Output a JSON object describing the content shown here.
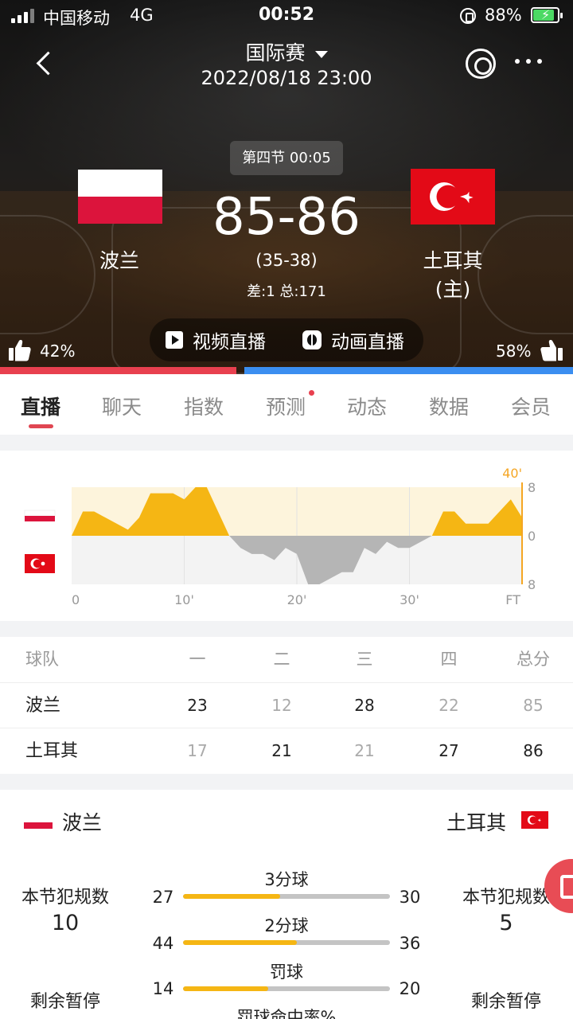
{
  "status_bar": {
    "carrier": "中国移动",
    "network": "4G",
    "time": "00:52",
    "battery": "88%",
    "battery_level": 0.88
  },
  "nav": {
    "title": "国际赛",
    "datetime": "2022/08/18 23:00"
  },
  "match": {
    "period": "第四节 00:05",
    "home": {
      "name": "波兰",
      "flag": "poland-flag"
    },
    "away": {
      "name": "土耳其",
      "tag": "(主)",
      "flag": "turkey-flag"
    },
    "score": "85-86",
    "halftime": "(35-38)",
    "diff_total": "差:1 总:171"
  },
  "live": {
    "video_label": "视频直播",
    "animation_label": "动画直播"
  },
  "support": {
    "home_pct_label": "42%",
    "away_pct_label": "58%",
    "home_share": 0.42,
    "home_color": "#e8404f",
    "away_color": "#3b8ef0"
  },
  "tabs": [
    {
      "label": "直播",
      "active": true
    },
    {
      "label": "聊天",
      "active": false
    },
    {
      "label": "指数",
      "active": false
    },
    {
      "label": "预测",
      "active": false,
      "dot": true
    },
    {
      "label": "动态",
      "active": false
    },
    {
      "label": "数据",
      "active": false
    },
    {
      "label": "会员",
      "active": false
    }
  ],
  "chart_data": {
    "type": "area",
    "x_tick_labels": [
      "0",
      "10'",
      "20'",
      "30'",
      "FT"
    ],
    "x_ticks": [
      0,
      10,
      20,
      30,
      40
    ],
    "y_tick_labels": [
      "8",
      "0",
      "8"
    ],
    "current_marker": "40'",
    "xlim": [
      0,
      40
    ],
    "ylim": [
      -8,
      8
    ],
    "positive_color": "#f5b614",
    "negative_color": "#b5b5b5",
    "marker_color": "#f5a623",
    "points": [
      [
        0,
        0
      ],
      [
        1,
        4
      ],
      [
        2,
        4
      ],
      [
        3,
        3
      ],
      [
        4,
        2
      ],
      [
        5,
        1
      ],
      [
        6,
        3
      ],
      [
        7,
        7
      ],
      [
        8,
        7
      ],
      [
        9,
        7
      ],
      [
        10,
        6
      ],
      [
        11,
        8
      ],
      [
        12,
        8
      ],
      [
        13,
        4
      ],
      [
        14,
        0
      ],
      [
        15,
        -2
      ],
      [
        16,
        -3
      ],
      [
        17,
        -3
      ],
      [
        18,
        -4
      ],
      [
        19,
        -2
      ],
      [
        20,
        -3
      ],
      [
        21,
        -8
      ],
      [
        22,
        -8
      ],
      [
        23,
        -7
      ],
      [
        24,
        -6
      ],
      [
        25,
        -6
      ],
      [
        26,
        -2
      ],
      [
        27,
        -3
      ],
      [
        28,
        -1
      ],
      [
        29,
        -2
      ],
      [
        30,
        -2
      ],
      [
        31,
        -1
      ],
      [
        32,
        0
      ],
      [
        33,
        4
      ],
      [
        34,
        4
      ],
      [
        35,
        2
      ],
      [
        36,
        2
      ],
      [
        37,
        2
      ],
      [
        38,
        4
      ],
      [
        39,
        6
      ],
      [
        40,
        3
      ]
    ]
  },
  "score_table": {
    "headers": [
      "球队",
      "一",
      "二",
      "三",
      "四",
      "总分"
    ],
    "rows": [
      {
        "team": "波兰",
        "cells": [
          "23",
          "12",
          "28",
          "22",
          "85"
        ],
        "bold": [
          true,
          false,
          true,
          false,
          false
        ]
      },
      {
        "team": "土耳其",
        "cells": [
          "17",
          "21",
          "21",
          "27",
          "86"
        ],
        "bold": [
          false,
          true,
          false,
          true,
          true
        ]
      }
    ]
  },
  "stats": {
    "home_name": "波兰",
    "away_name": "土耳其",
    "fouls_label": "本节犯规数",
    "home_fouls": "10",
    "away_fouls": "5",
    "timeouts_label": "剩余暂停",
    "rows": [
      {
        "title": "3分球",
        "home": "27",
        "away": "30",
        "home_share": 0.47
      },
      {
        "title": "2分球",
        "home": "44",
        "away": "36",
        "home_share": 0.55
      },
      {
        "title": "罚球",
        "home": "14",
        "away": "20",
        "home_share": 0.41
      }
    ],
    "next_title": "罚球命中率%"
  }
}
